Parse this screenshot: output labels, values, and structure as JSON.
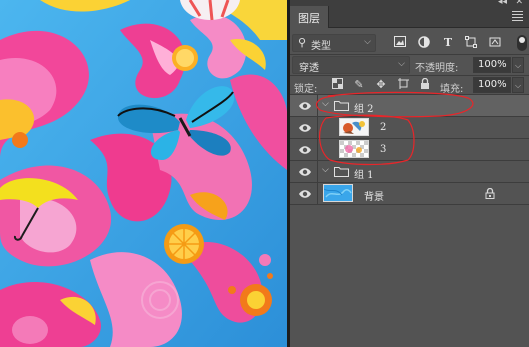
{
  "panel": {
    "tab_label": "图层",
    "collapse_glyph": "◂◂",
    "close_glyph": "✕",
    "filter": {
      "kind_label": "类型",
      "icons": [
        "image-filter-icon",
        "adjustment-filter-icon",
        "type-filter-icon",
        "shape-filter-icon",
        "smart-object-filter-icon"
      ],
      "toggle_state": "on"
    },
    "blend_mode": "穿透",
    "opacity_label": "不透明度:",
    "opacity_value": "100%",
    "lock_label": "锁定:",
    "fill_label": "填充:",
    "fill_value": "100%"
  },
  "layers": [
    {
      "type": "group",
      "name": "组 2",
      "expanded": true,
      "visible": true,
      "selected": true,
      "indent": 0
    },
    {
      "type": "layer",
      "name": "2",
      "visible": true,
      "indent": 1,
      "thumbnail": "clip-art-thumbnail"
    },
    {
      "type": "layer",
      "name": "3",
      "visible": true,
      "indent": 1,
      "thumbnail": "transparent-thumbnail"
    },
    {
      "type": "group",
      "name": "组 1",
      "expanded": true,
      "visible": true,
      "indent": 0
    },
    {
      "type": "layer",
      "name": "背景",
      "visible": true,
      "indent": 0,
      "locked": true,
      "thumbnail": "background-thumbnail"
    }
  ],
  "colors": {
    "panel_bg": "#535353",
    "selected_row": "#626262",
    "annotation_red": "#e8262a",
    "canvas_blue": "#2f9be0"
  }
}
